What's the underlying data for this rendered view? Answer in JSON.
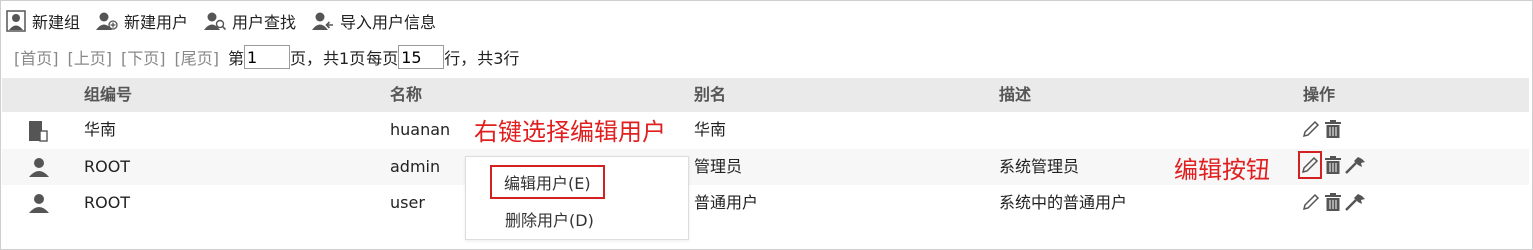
{
  "toolbar": {
    "new_group": "新建组",
    "new_user": "新建用户",
    "find_user": "用户查找",
    "import_users": "导入用户信息"
  },
  "pager": {
    "first": "[首页]",
    "prev": "[上页]",
    "next": "[下页]",
    "last": "[尾页]",
    "page_prefix": "第",
    "page_value": "1",
    "page_suffix": "页，",
    "total_pages": "共1页",
    "per_page_prefix": "每页",
    "per_page_value": "15",
    "per_page_suffix": "行，",
    "total_rows": "共3行"
  },
  "table": {
    "headers": [
      "组编号",
      "名称",
      "别名",
      "描述",
      "操作"
    ],
    "rows": [
      {
        "icon": "group-icon",
        "id": "华南",
        "name": "huanan",
        "alias": "华南",
        "desc": ""
      },
      {
        "icon": "user-icon",
        "id": "ROOT",
        "name": "admin",
        "alias": "管理员",
        "desc": "系统管理员"
      },
      {
        "icon": "user-icon",
        "id": "ROOT",
        "name": "user",
        "alias": "普通用户",
        "desc": "系统中的普通用户"
      }
    ]
  },
  "context_menu": {
    "edit": "编辑用户(E)",
    "delete": "删除用户(D)"
  },
  "annotations": {
    "right_click": "右键选择编辑用户",
    "edit_button": "编辑按钮"
  },
  "colors": {
    "annotation": "#e02020",
    "header_bg": "#eaeaea"
  }
}
